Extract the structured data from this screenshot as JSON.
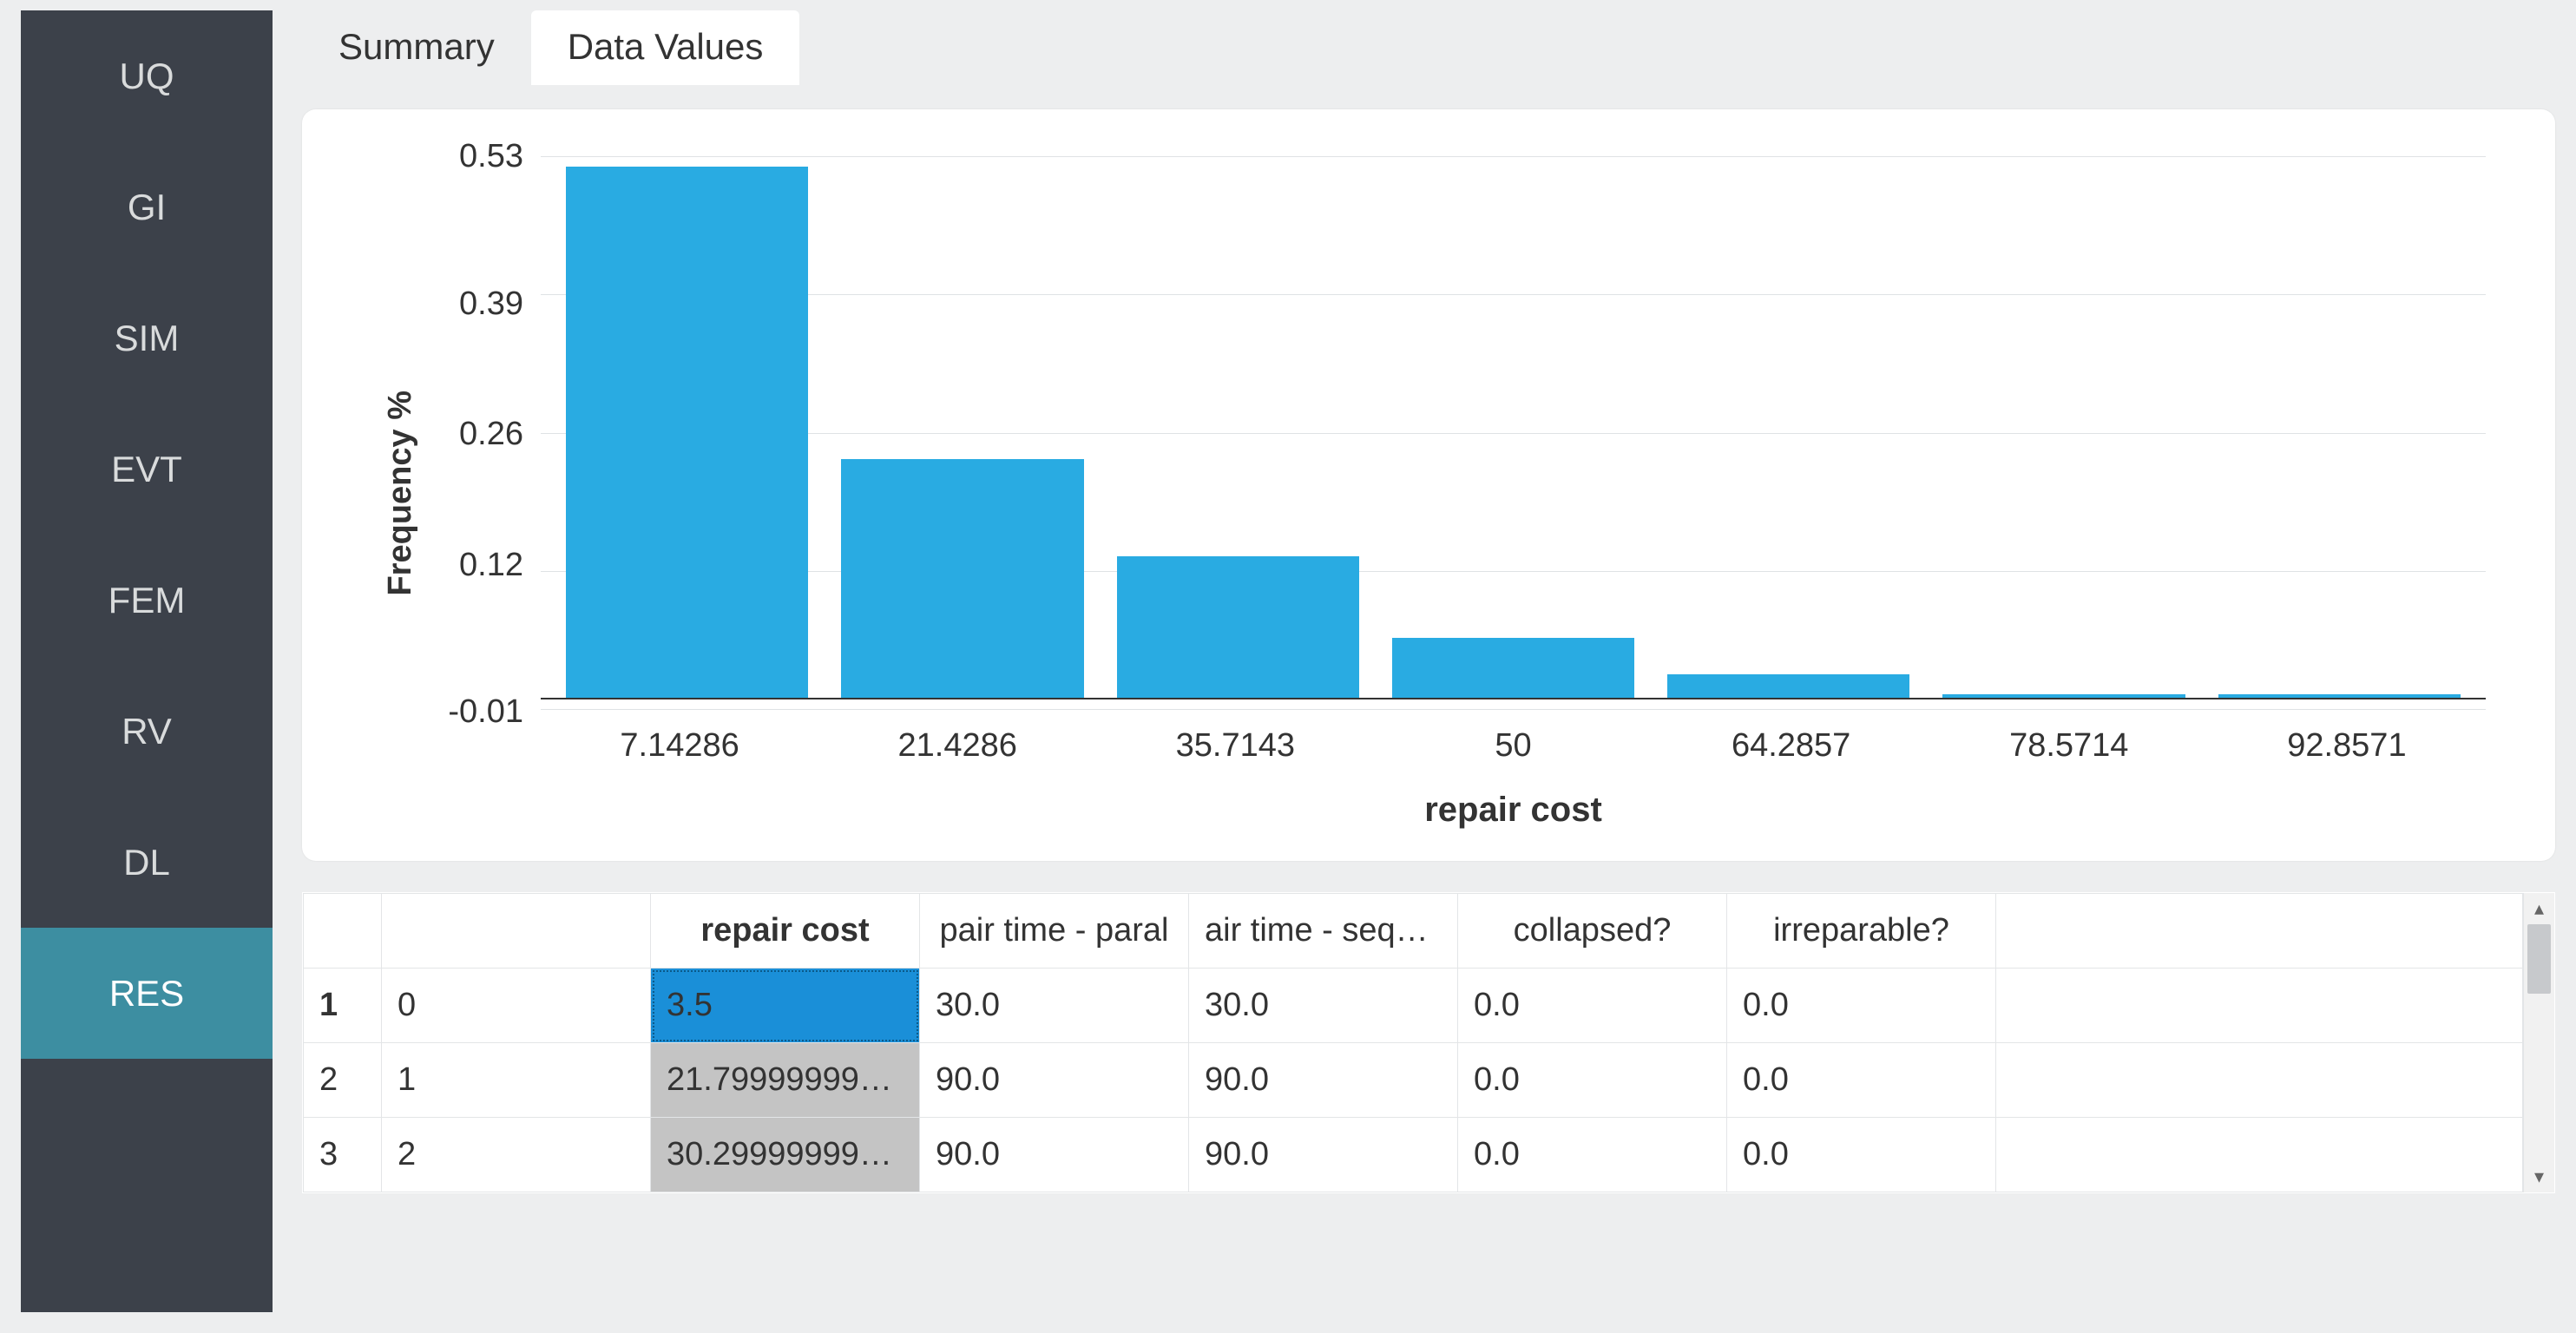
{
  "sidebar": {
    "items": [
      {
        "label": "UQ",
        "active": false
      },
      {
        "label": "GI",
        "active": false
      },
      {
        "label": "SIM",
        "active": false
      },
      {
        "label": "EVT",
        "active": false
      },
      {
        "label": "FEM",
        "active": false
      },
      {
        "label": "RV",
        "active": false
      },
      {
        "label": "DL",
        "active": false
      },
      {
        "label": "RES",
        "active": true
      }
    ]
  },
  "tabs": [
    {
      "label": "Summary",
      "active": false
    },
    {
      "label": "Data Values",
      "active": true
    }
  ],
  "chart_data": {
    "type": "bar",
    "xlabel": "repair cost",
    "ylabel": "Frequency %",
    "categories": [
      "7.14286",
      "21.4286",
      "35.7143",
      "50",
      "64.2857",
      "78.5714",
      "92.8571"
    ],
    "values": [
      0.52,
      0.235,
      0.14,
      0.06,
      0.025,
      0.005,
      0.005
    ],
    "yticks": [
      "0.53",
      "0.39",
      "0.26",
      "0.12",
      "-0.01"
    ],
    "ylim": [
      -0.01,
      0.53
    ]
  },
  "table": {
    "corner": "",
    "index_header": "",
    "columns": [
      "repair cost",
      "pair time - paral",
      "air time - sequer",
      "collapsed?",
      "irreparable?"
    ],
    "active_column": 0,
    "rows": [
      {
        "rownum": "1",
        "idx": "0",
        "cells": [
          "3.5",
          "30.0",
          "30.0",
          "0.0",
          "0.0"
        ],
        "bold": true,
        "selected_cell": 0
      },
      {
        "rownum": "2",
        "idx": "1",
        "cells": [
          "21.799999999...",
          "90.0",
          "90.0",
          "0.0",
          "0.0"
        ]
      },
      {
        "rownum": "3",
        "idx": "2",
        "cells": [
          "30.299999999...",
          "90.0",
          "90.0",
          "0.0",
          "0.0"
        ]
      }
    ]
  },
  "scrollbar": {
    "up": "▴",
    "down": "▾"
  }
}
